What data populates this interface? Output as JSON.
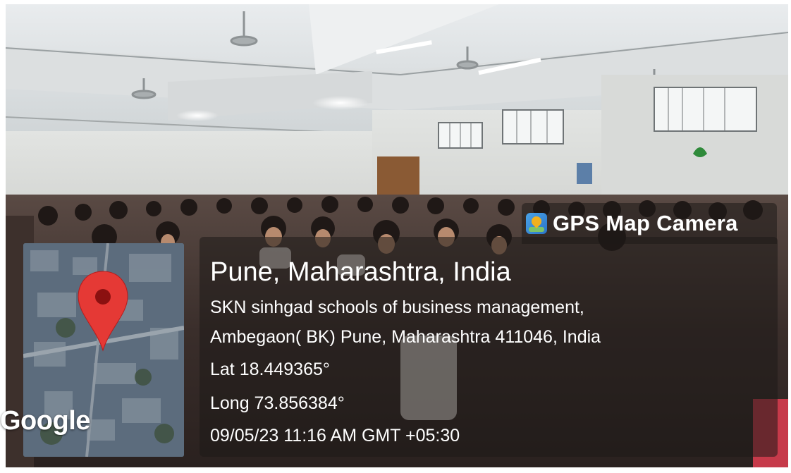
{
  "overlay": {
    "app_name": "GPS Map Camera",
    "place_title": "Pune, Maharashtra, India",
    "address_line_1": "SKN sinhgad schools of business management,",
    "address_line_2": "Ambegaon( BK) Pune, Maharashtra 411046, India",
    "latitude": "Lat 18.449365°",
    "longitude": "Long 73.856384°",
    "timestamp": "09/05/23 11:16 AM GMT +05:30"
  },
  "map": {
    "brand": "Google",
    "pin_icon": "map-pin-icon",
    "pin_color": "#e53935"
  },
  "app_icon": "gps-map-camera-icon",
  "colors": {
    "overlay_bg": "#1e1a18",
    "text": "#ffffff"
  }
}
